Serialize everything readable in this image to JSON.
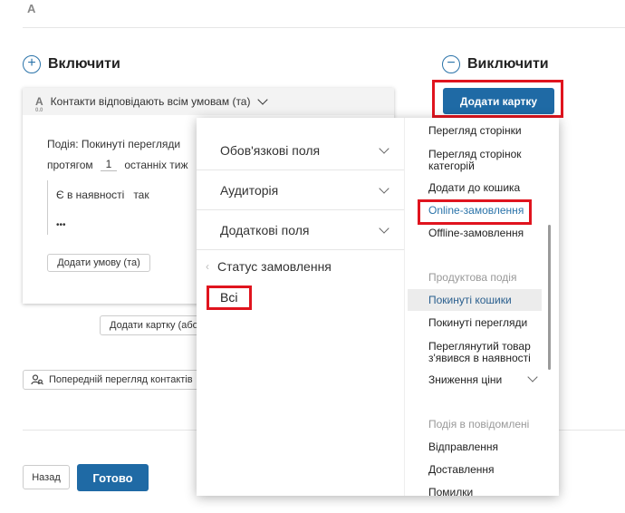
{
  "top_letter": "A",
  "include": {
    "title": "Включити",
    "icon": "plus-circle-icon"
  },
  "exclude": {
    "title": "Виключити",
    "icon": "minus-circle-icon",
    "add_card_label": "Додати картку"
  },
  "card": {
    "header_letter": "A",
    "header_sub": "0.0",
    "header_title": "Контакти відповідають всім умовам (та)",
    "event_line": "Подія: Покинуті перегляди",
    "period_prefix": "протягом",
    "period_value": "1",
    "period_suffix": "останніх тиж",
    "condition_left": "Є в наявності",
    "condition_right": "так",
    "ellipsis": "•••",
    "add_condition_label": "Додати умову (та)"
  },
  "add_card_or_label": "Додати картку (або",
  "preview_label": "Попередній перегляд контактів",
  "footer": {
    "back_label": "Назад",
    "done_label": "Готово"
  },
  "popup": {
    "sections": [
      {
        "label": "Обов'язкові поля"
      },
      {
        "label": "Аудиторія"
      },
      {
        "label": "Додаткові поля"
      }
    ],
    "back_label": "Статус замовлення",
    "selected_value": "Всі"
  },
  "right_list": {
    "items_a": [
      "Перегляд сторінки",
      "Перегляд сторінок категорій",
      "Додати до кошика",
      "Online-замовлення",
      "Offline-замовлення"
    ],
    "group_product": "Продуктова подія",
    "items_b": [
      "Покинуті кошики",
      "Покинуті перегляди",
      "Переглянутий товар з'явився в наявності",
      "Зниження ціни"
    ],
    "group_message": "Подія в повідомлені",
    "items_c": [
      "Відправлення",
      "Доставлення",
      "Помилки"
    ]
  },
  "colors": {
    "accent": "#1f6aa5",
    "highlight": "#e0141e",
    "selected_text": "#2a73a9"
  }
}
